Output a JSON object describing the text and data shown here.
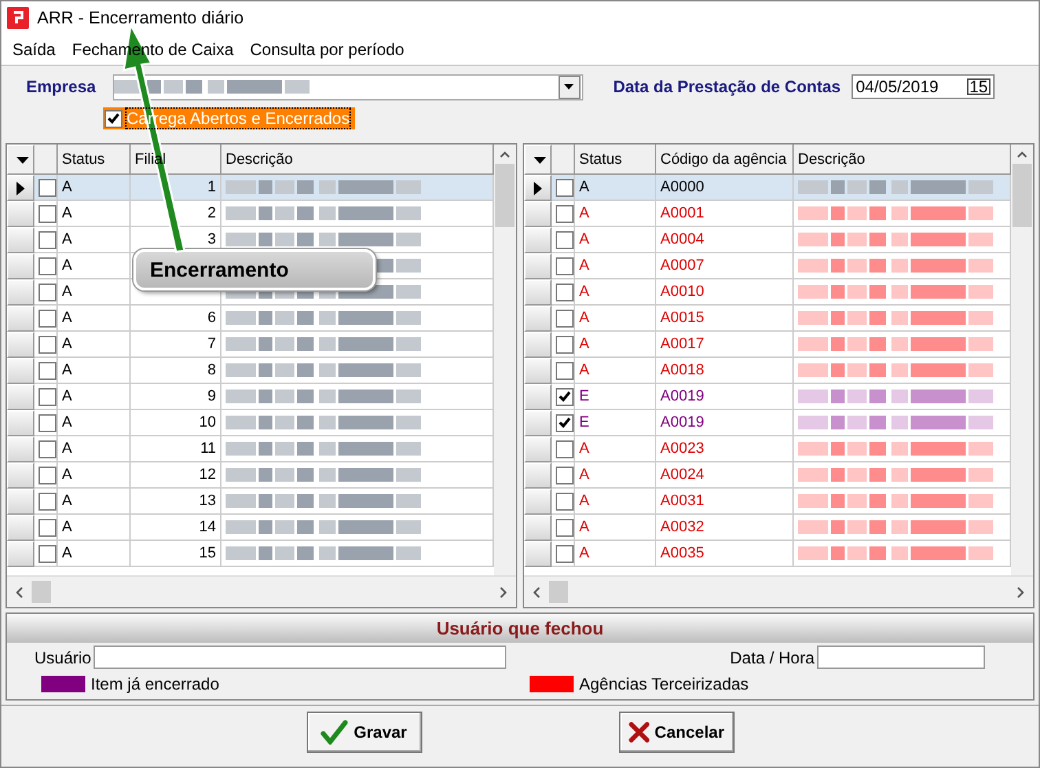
{
  "window": {
    "title": "ARR - Encerramento diário"
  },
  "menu": [
    "Saída",
    "Fechamento de Caixa",
    "Consulta por período"
  ],
  "filter": {
    "company_label": "Empresa",
    "date_label": "Data da Prestação de Contas",
    "date_value": "04/05/2019",
    "calendar_button": "15",
    "load_all": {
      "label": "Carrega Abertos e Encerrados",
      "checked": true
    }
  },
  "left_grid": {
    "columns": [
      "Status",
      "Filial",
      "Descrição"
    ],
    "rows": [
      {
        "selected": true,
        "checked": false,
        "status": "A",
        "filial": "1"
      },
      {
        "selected": false,
        "checked": false,
        "status": "A",
        "filial": "2"
      },
      {
        "selected": false,
        "checked": false,
        "status": "A",
        "filial": "3"
      },
      {
        "selected": false,
        "checked": false,
        "status": "A"
      },
      {
        "selected": false,
        "checked": false,
        "status": "A"
      },
      {
        "selected": false,
        "checked": false,
        "status": "A",
        "filial": "6"
      },
      {
        "selected": false,
        "checked": false,
        "status": "A",
        "filial": "7"
      },
      {
        "selected": false,
        "checked": false,
        "status": "A",
        "filial": "8"
      },
      {
        "selected": false,
        "checked": false,
        "status": "A",
        "filial": "9"
      },
      {
        "selected": false,
        "checked": false,
        "status": "A",
        "filial": "10"
      },
      {
        "selected": false,
        "checked": false,
        "status": "A",
        "filial": "11"
      },
      {
        "selected": false,
        "checked": false,
        "status": "A",
        "filial": "12"
      },
      {
        "selected": false,
        "checked": false,
        "status": "A",
        "filial": "13"
      },
      {
        "selected": false,
        "checked": false,
        "status": "A",
        "filial": "14"
      },
      {
        "selected": false,
        "checked": false,
        "status": "A",
        "filial": "15"
      }
    ]
  },
  "right_grid": {
    "columns": [
      "Status",
      "Código da agência",
      "Descrição"
    ],
    "rows": [
      {
        "selected": true,
        "checked": false,
        "status": "A",
        "code": "A0000",
        "kind": "normal"
      },
      {
        "selected": false,
        "checked": false,
        "status": "A",
        "code": "A0001",
        "kind": "outsourced"
      },
      {
        "selected": false,
        "checked": false,
        "status": "A",
        "code": "A0004",
        "kind": "outsourced"
      },
      {
        "selected": false,
        "checked": false,
        "status": "A",
        "code": "A0007",
        "kind": "outsourced"
      },
      {
        "selected": false,
        "checked": false,
        "status": "A",
        "code": "A0010",
        "kind": "outsourced"
      },
      {
        "selected": false,
        "checked": false,
        "status": "A",
        "code": "A0015",
        "kind": "outsourced"
      },
      {
        "selected": false,
        "checked": false,
        "status": "A",
        "code": "A0017",
        "kind": "outsourced"
      },
      {
        "selected": false,
        "checked": false,
        "status": "A",
        "code": "A0018",
        "kind": "outsourced"
      },
      {
        "selected": false,
        "checked": true,
        "status": "E",
        "code": "A0019",
        "kind": "closed"
      },
      {
        "selected": false,
        "checked": true,
        "status": "E",
        "code": "A0019",
        "kind": "closed"
      },
      {
        "selected": false,
        "checked": false,
        "status": "A",
        "code": "A0023",
        "kind": "outsourced"
      },
      {
        "selected": false,
        "checked": false,
        "status": "A",
        "code": "A0024",
        "kind": "outsourced"
      },
      {
        "selected": false,
        "checked": false,
        "status": "A",
        "code": "A0031",
        "kind": "outsourced"
      },
      {
        "selected": false,
        "checked": false,
        "status": "A",
        "code": "A0032",
        "kind": "outsourced"
      },
      {
        "selected": false,
        "checked": false,
        "status": "A",
        "code": "A0035",
        "kind": "outsourced"
      }
    ]
  },
  "closed_by": {
    "title": "Usuário que fechou",
    "user_label": "Usuário",
    "datetime_label": "Data / Hora"
  },
  "legend": [
    {
      "label": "Item já encerrado",
      "color": "#800080"
    },
    {
      "label": "Agências Terceirizadas",
      "color": "#ff0000"
    }
  ],
  "buttons": [
    {
      "label": "Gravar",
      "kind": "save"
    },
    {
      "label": "Cancelar",
      "kind": "cancel"
    }
  ],
  "annotation": {
    "label": "Encerramento"
  }
}
